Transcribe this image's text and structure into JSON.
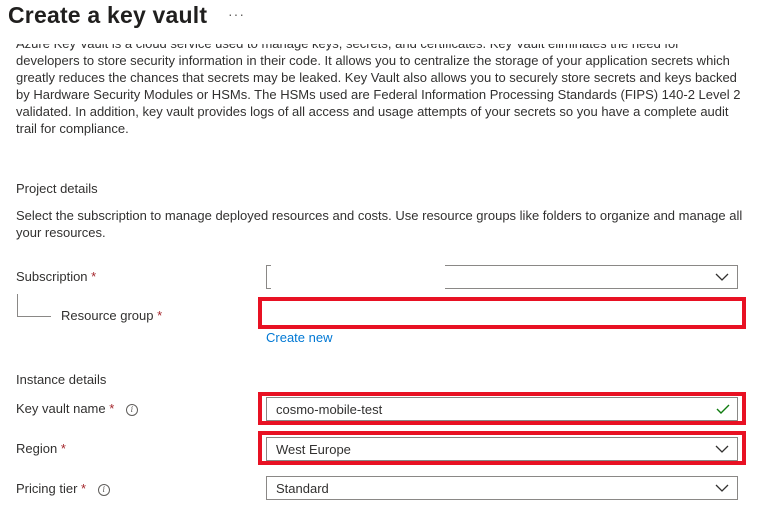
{
  "header": {
    "title": "Create a key vault",
    "more_label": "···"
  },
  "intro": {
    "text": "Azure Key Vault is a cloud service used to manage keys, secrets, and certificates. Key Vault eliminates the need for developers to store security information in their code. It allows you to centralize the storage of your application secrets which greatly reduces the chances that secrets may be leaked. Key Vault also allows you to securely store secrets and keys backed by Hardware Security Modules or HSMs. The HSMs used are Federal Information Processing Standards (FIPS) 140-2 Level 2 validated. In addition, key vault provides logs of all access and usage attempts of your secrets so you have a complete audit trail for compliance."
  },
  "project_details": {
    "heading": "Project details",
    "description": "Select the subscription to manage deployed resources and costs. Use resource groups like folders to organize and manage all your resources.",
    "subscription": {
      "label": "Subscription",
      "required_mark": "*",
      "value": "",
      "icon": "chevron-down-icon"
    },
    "resource_group": {
      "label": "Resource group",
      "required_mark": "*",
      "value": "",
      "create_new_label": "Create new"
    }
  },
  "instance_details": {
    "heading": "Instance details",
    "key_vault_name": {
      "label": "Key vault name",
      "required_mark": "*",
      "value": "cosmo-mobile-test",
      "info_icon": "info-icon",
      "valid_icon": "checkmark-icon"
    },
    "region": {
      "label": "Region",
      "required_mark": "*",
      "value": "West Europe",
      "icon": "chevron-down-icon"
    },
    "pricing_tier": {
      "label": "Pricing tier",
      "required_mark": "*",
      "value": "Standard",
      "info_icon": "info-icon",
      "icon": "chevron-down-icon"
    }
  },
  "colors": {
    "highlight": "#e81123",
    "link": "#0078d4",
    "required": "#a4262c",
    "valid_check": "#107c10"
  }
}
